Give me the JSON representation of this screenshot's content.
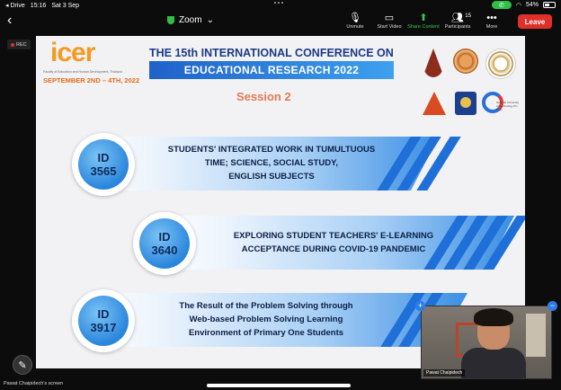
{
  "statusbar": {
    "back_app": "◂ Drive",
    "time": "15:16",
    "date": "Sat 3 Sep",
    "battery": "54%"
  },
  "topbar": {
    "app_title": "Zoom",
    "tools": [
      {
        "label": "Unmute",
        "icon": "microphone-muted-icon"
      },
      {
        "label": "Start Video",
        "icon": "camera-off-icon"
      },
      {
        "label": "Share Content",
        "icon": "share-icon"
      },
      {
        "label": "Participants",
        "icon": "participants-icon",
        "count": "15"
      },
      {
        "label": "More",
        "icon": "more-icon"
      }
    ],
    "leave_label": "Leave"
  },
  "rec_label": "REC",
  "slide": {
    "logo_word": "icer",
    "logo_tagline": "Faculty of Education and Human Development, Thailand",
    "logo_date": "SEPTEMBER 2ND – 4TH, 2022",
    "conf_title": "THE 15th INTERNATIONAL CONFERENCE ON",
    "conf_banner": "EDUCATIONAL RESEARCH 2022",
    "session": "Session 2",
    "emblem_caption": "National University of Technology Pin Thao",
    "rows": [
      {
        "id_label": "ID",
        "id_number": "3565",
        "title_lines": [
          "STUDENTS' INTEGRATED WORK IN TUMULTUOUS",
          "TIME; SCIENCE, SOCIAL STUDY,",
          "ENGLISH SUBJECTS"
        ]
      },
      {
        "id_label": "ID",
        "id_number": "3640",
        "title_lines": [
          "EXPLORING STUDENT TEACHERS' E-LEARNING",
          "ACCEPTANCE DURING COVID-19 PANDEMIC"
        ]
      },
      {
        "id_label": "ID",
        "id_number": "3917",
        "title_lines": [
          "The Result of the Problem Solving through",
          "Web-based Problem Solving Learning",
          "Environment of Primary One Students"
        ]
      }
    ]
  },
  "video": {
    "participant_name": "Pawat Chaipidech"
  },
  "screen_label": "Pawat Chaipidech's screen",
  "colors": {
    "leave": "#e0302a",
    "banner": "#1f62c9",
    "accent_orange": "#f59a1e",
    "share_green": "#35c759"
  }
}
